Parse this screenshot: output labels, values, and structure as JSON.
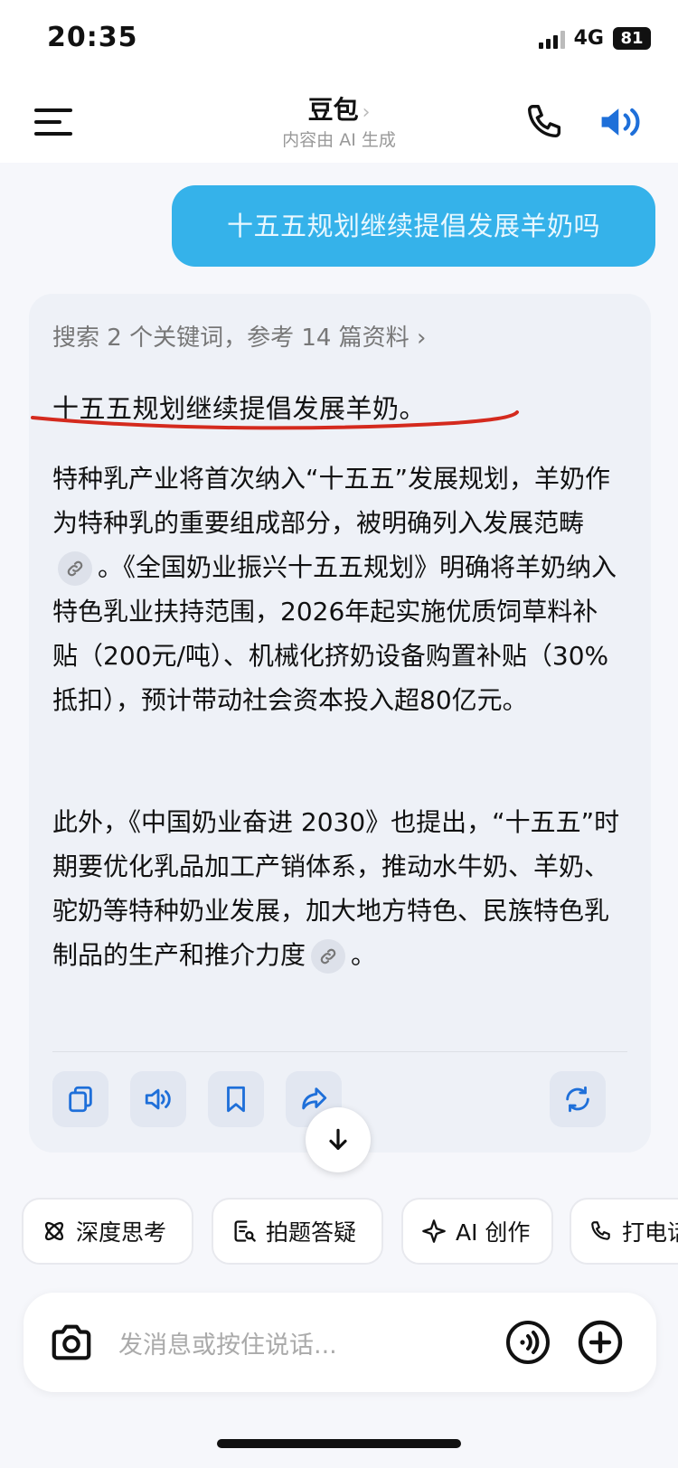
{
  "status_bar": {
    "time": "20:35",
    "network": "4G",
    "battery": "81"
  },
  "nav": {
    "title": "豆包",
    "title_chevron": "›",
    "subtitle": "内容由 AI 生成",
    "icons": [
      "menu-icon",
      "call-icon",
      "speaker-icon"
    ]
  },
  "chat": {
    "user_message": "十五五规划继续提倡发展羊奶吗",
    "ai_reply": {
      "search_summary": "搜索 2 个关键词，参考 14 篇资料 ›",
      "highlight": "十五五规划继续提倡发展羊奶。",
      "para1_a": "特种乳产业将首次纳入“十五五”发展规划，羊奶作为特种乳的重要组成部分，被明确列入发展范畴",
      "para1_b": "。《全国奶业振兴十五五规划》明确将羊奶纳入特色乳业扶持范围，2026年起实施优质饲草料补贴（200元/吨）、机械化挤奶设备购置补贴（30%抵扣），预计带动社会资本投入超80亿元。",
      "para2_a": "此外，《中国奶业奋进 2030》也提出，“十五五”时期要优化乳品加工产销体系，推动水牛奶、羊奶、驼奶等特种奶业发展，加大地方特色、民族特色乳制品的生产和推介力度",
      "para2_b": "。"
    },
    "actions": [
      "copy-icon",
      "read-aloud-icon",
      "bookmark-icon",
      "share-icon",
      "regenerate-icon"
    ]
  },
  "quick_chips": [
    {
      "icon": "atom-icon",
      "label": "深度思考"
    },
    {
      "icon": "photo-question-icon",
      "label": "拍题答疑"
    },
    {
      "icon": "sparkle-icon",
      "label": "AI 创作"
    },
    {
      "icon": "phone-icon",
      "label": "打电话"
    }
  ],
  "input": {
    "placeholder": "发消息或按住说话..."
  },
  "colors": {
    "user_bubble": "#35b2ea",
    "accent_blue": "#1e6fd9",
    "underline_red": "#d42a1e",
    "card_bg": "#eef1f7"
  }
}
